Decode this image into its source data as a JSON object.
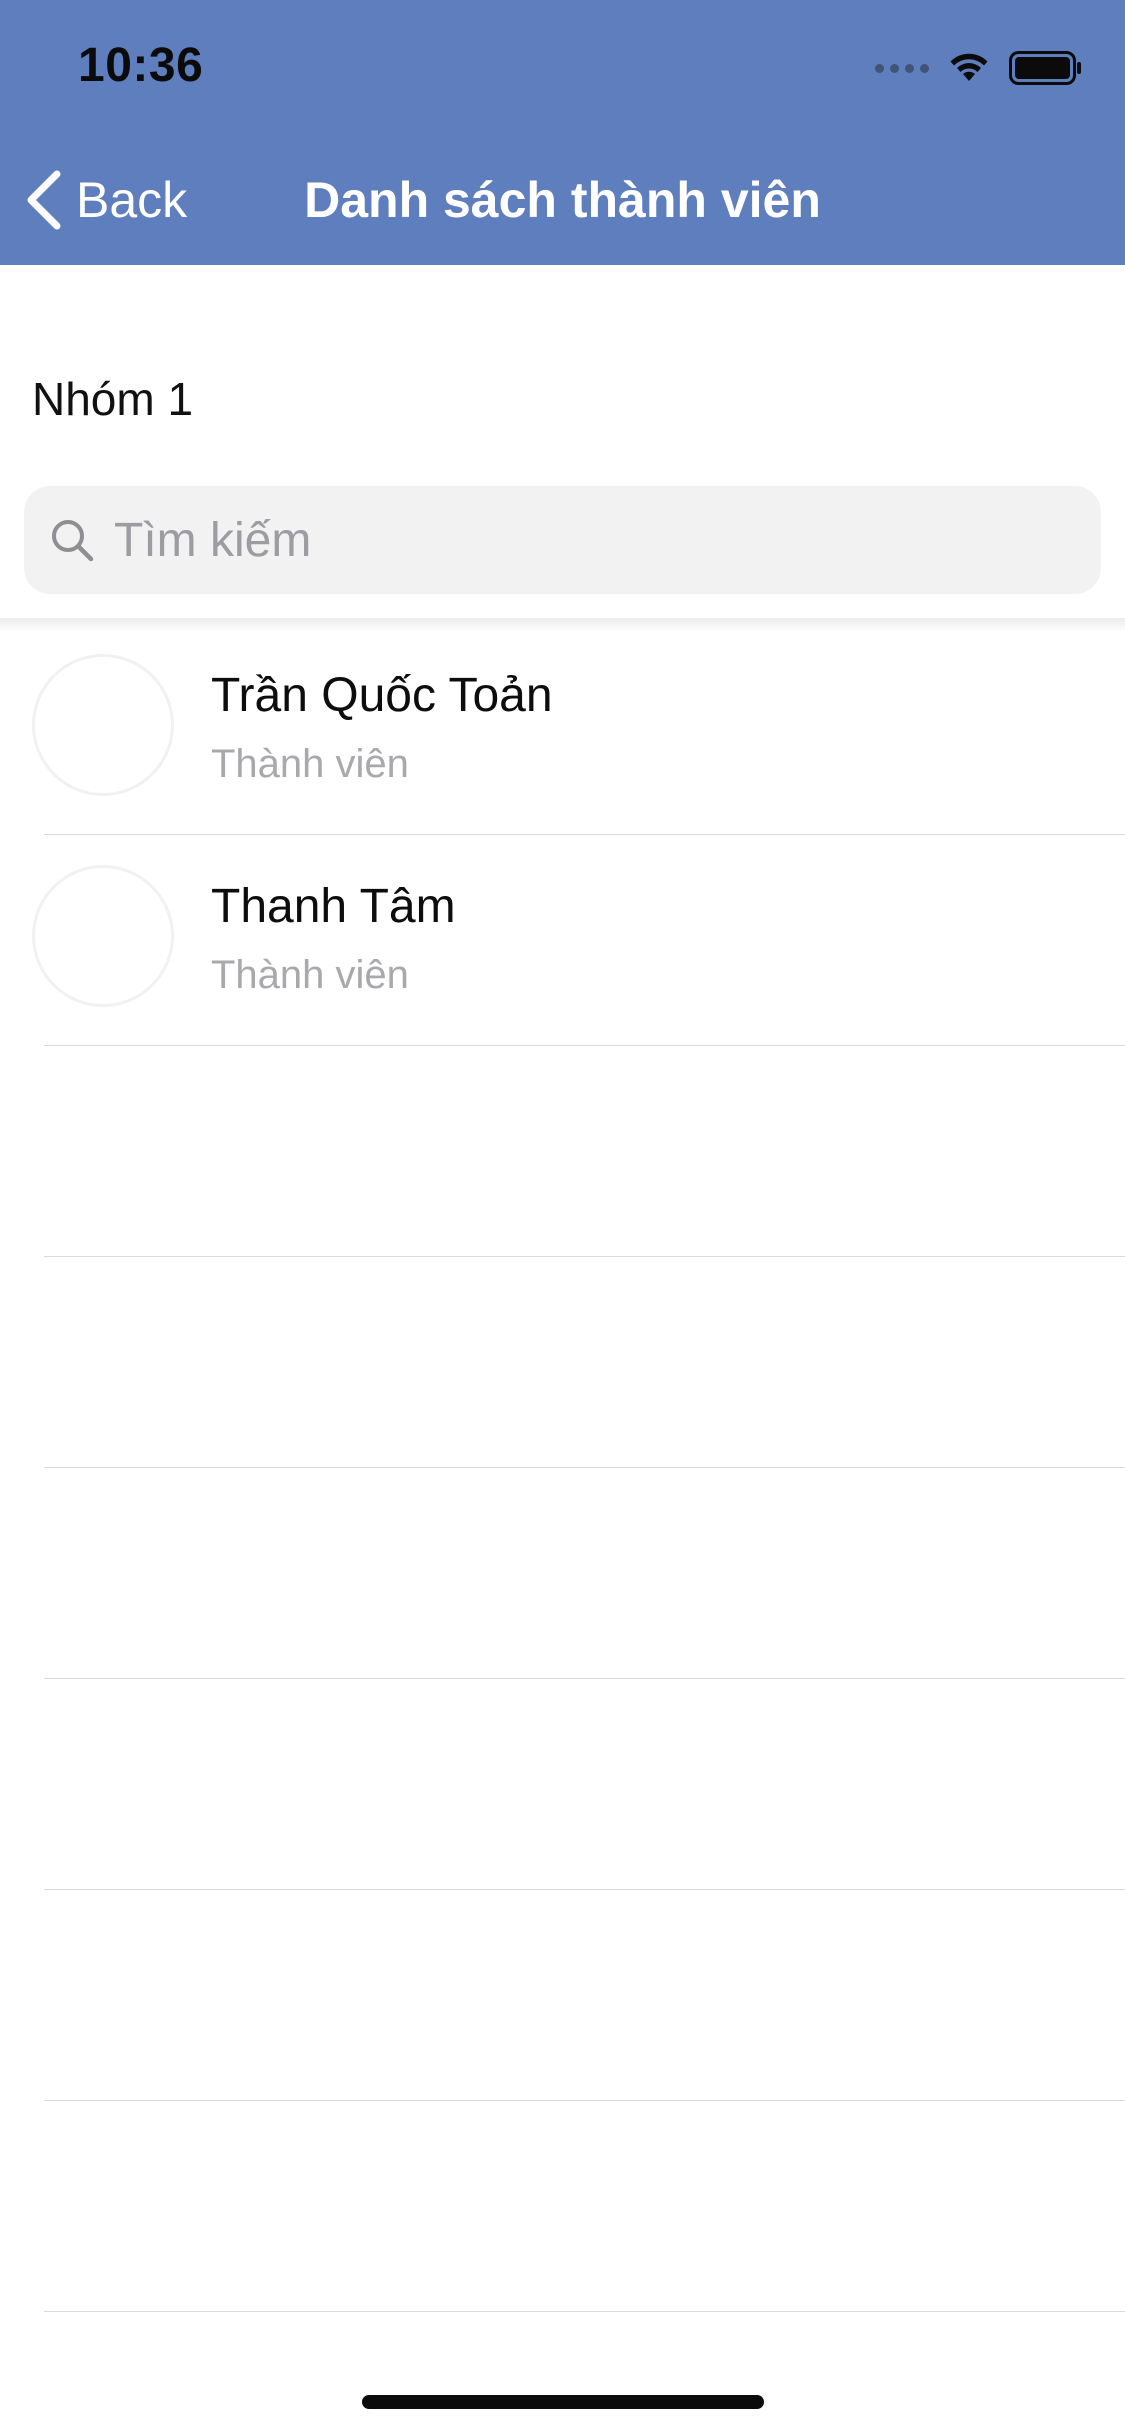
{
  "status_bar": {
    "time": "10:36"
  },
  "nav": {
    "back_label": "Back",
    "title": "Danh sách thành viên",
    "background_color": "#5e7ebd"
  },
  "group": {
    "name": "Nhóm 1"
  },
  "search": {
    "placeholder": "Tìm kiếm",
    "value": ""
  },
  "members": [
    {
      "name": "Trần Quốc Toản",
      "role": "Thành viên"
    },
    {
      "name": "Thanh Tâm",
      "role": "Thành viên"
    }
  ],
  "icons": {
    "back": "chevron-left-icon",
    "search": "search-icon",
    "wifi": "wifi-icon",
    "battery": "battery-icon",
    "signal": "cellular-signal-icon"
  }
}
